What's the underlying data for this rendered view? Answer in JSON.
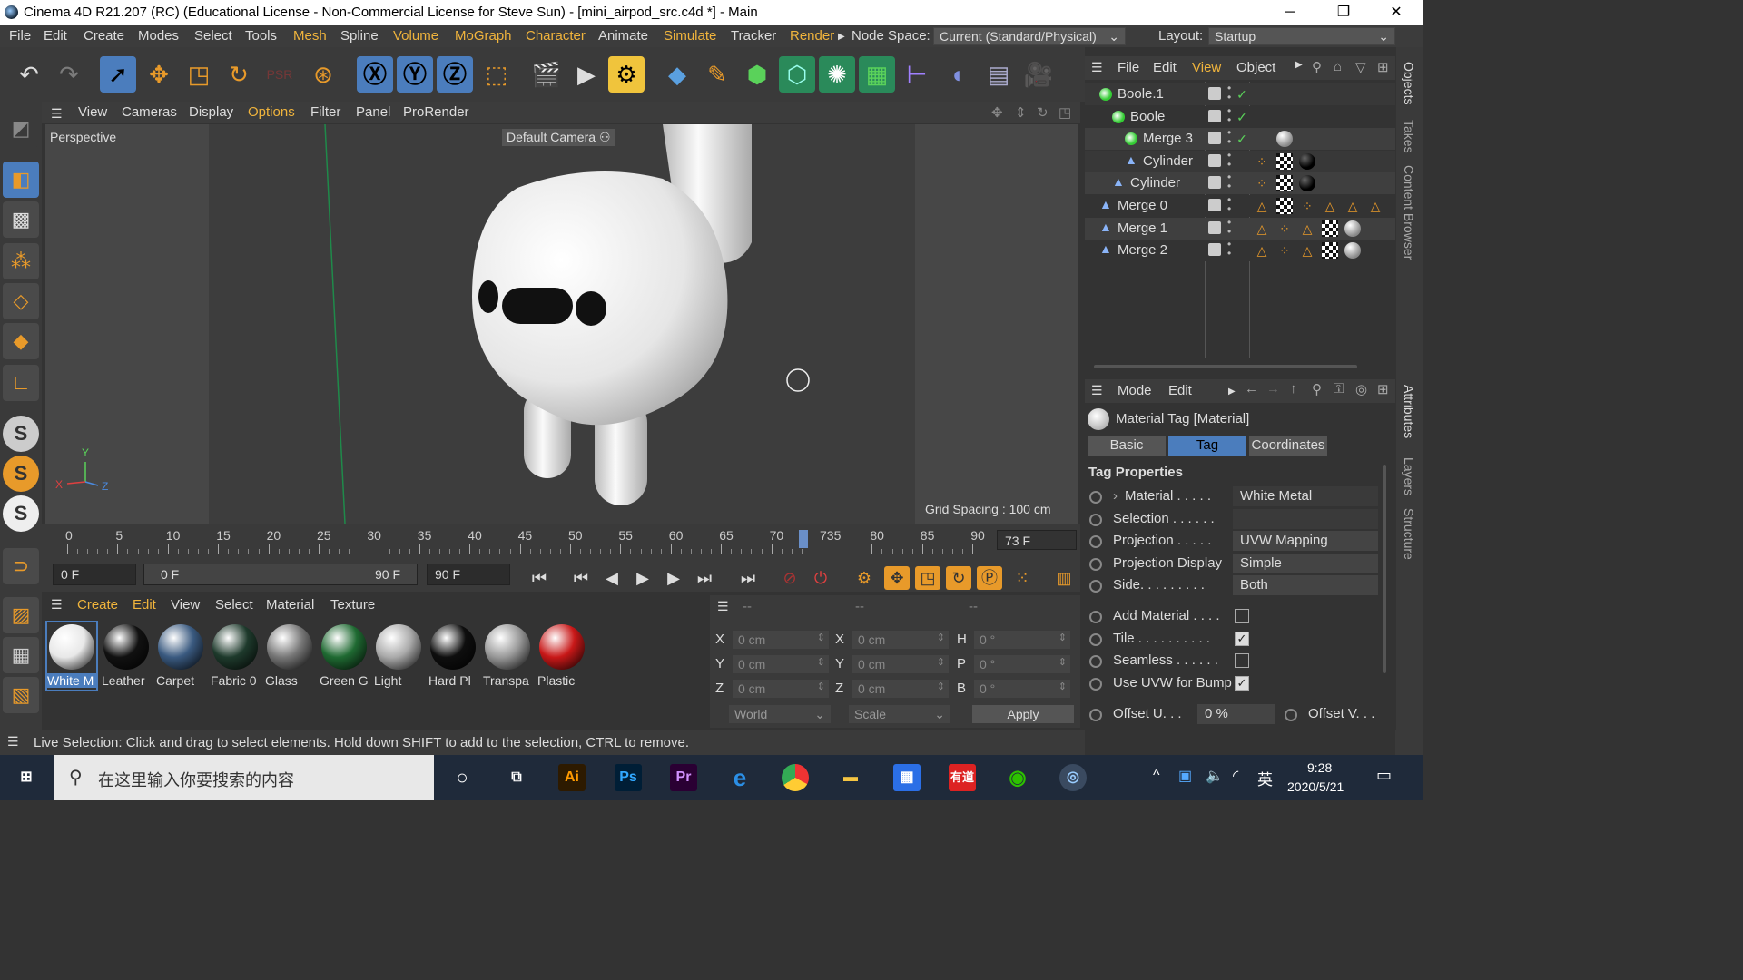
{
  "window": {
    "title": "Cinema 4D R21.207 (RC) (Educational License - Non-Commercial License for Steve Sun) - [mini_airpod_src.c4d *] - Main",
    "minimize": "─",
    "restore": "❐",
    "close": "✕"
  },
  "menu": {
    "items": [
      "File",
      "Edit",
      "Create",
      "Modes",
      "Select",
      "Tools",
      "Mesh",
      "Spline",
      "Volume",
      "MoGraph",
      "Character",
      "Animate",
      "Simulate",
      "Tracker",
      "Render"
    ],
    "node_space_label": "Node Space:",
    "node_space_value": "Current (Standard/Physical)",
    "layout_label": "Layout:",
    "layout_value": "Startup"
  },
  "viewport": {
    "menu": [
      "View",
      "Cameras",
      "Display",
      "Options",
      "Filter",
      "Panel",
      "ProRender"
    ],
    "name": "Perspective",
    "camera": "Default Camera",
    "grid_spacing": "Grid Spacing : 100 cm",
    "axis_x": "X",
    "axis_y": "Y",
    "axis_z": "Z"
  },
  "timeline": {
    "ticks": [
      "0",
      "5",
      "10",
      "15",
      "20",
      "25",
      "30",
      "35",
      "40",
      "45",
      "50",
      "55",
      "60",
      "65",
      "70",
      "735",
      "80",
      "85",
      "90"
    ],
    "current_frame": "73 F",
    "start_field": "0 F",
    "range_start": "0 F",
    "range_end": "90 F",
    "end_field": "90 F"
  },
  "materials": {
    "menu": [
      "Create",
      "Edit",
      "View",
      "Select",
      "Material",
      "Texture"
    ],
    "items": [
      {
        "label": "White M",
        "color": "#e8e8e8"
      },
      {
        "label": "Leather",
        "color": "#111111"
      },
      {
        "label": "Carpet",
        "color": "#3a5a80"
      },
      {
        "label": "Fabric 0",
        "color": "#1e3a2c"
      },
      {
        "label": "Glass",
        "color": "#777777"
      },
      {
        "label": "Green G",
        "color": "#1f6a32"
      },
      {
        "label": "Light",
        "color": "#aaaaaa"
      },
      {
        "label": "Hard Pl",
        "color": "#0e0e0e"
      },
      {
        "label": "Transpa",
        "color": "#999999"
      },
      {
        "label": "Plastic",
        "color": "#c81818"
      }
    ]
  },
  "coords": {
    "headers": [
      "--",
      "--",
      "--"
    ],
    "rows": [
      {
        "l1": "X",
        "v1": "0 cm",
        "l2": "X",
        "v2": "0 cm",
        "l3": "H",
        "v3": "0 °"
      },
      {
        "l1": "Y",
        "v1": "0 cm",
        "l2": "Y",
        "v2": "0 cm",
        "l3": "P",
        "v3": "0 °"
      },
      {
        "l1": "Z",
        "v1": "0 cm",
        "l2": "Z",
        "v2": "0 cm",
        "l3": "B",
        "v3": "0 °"
      }
    ],
    "world": "World",
    "scale": "Scale",
    "apply": "Apply"
  },
  "status": "Live Selection: Click and drag to select elements. Hold down SHIFT to add to the selection, CTRL to remove.",
  "objects": {
    "menu": [
      "File",
      "Edit",
      "View",
      "Object"
    ],
    "items": [
      {
        "name": "Boole.1"
      },
      {
        "name": "Boole"
      },
      {
        "name": "Merge 3"
      },
      {
        "name": "Cylinder"
      },
      {
        "name": "Cylinder"
      },
      {
        "name": "Merge 0"
      },
      {
        "name": "Merge 1"
      },
      {
        "name": "Merge 2"
      }
    ]
  },
  "attributes": {
    "menu": [
      "Mode",
      "Edit"
    ],
    "title": "Material Tag [Material]",
    "tabs": [
      "Basic",
      "Tag",
      "Coordinates"
    ],
    "section": "Tag Properties",
    "rows": [
      {
        "label": "Material . . . . .",
        "value": "White Metal"
      },
      {
        "label": "Selection . . . . . .",
        "value": ""
      },
      {
        "label": "Projection . . . . .",
        "value": "UVW Mapping"
      },
      {
        "label": "Projection Display",
        "value": "Simple"
      },
      {
        "label": "Side. . . . . . . . .",
        "value": "Both"
      }
    ],
    "checks": [
      {
        "label": "Add Material . . . .",
        "checked": false
      },
      {
        "label": "Tile . . . . . . . . . .",
        "checked": true
      },
      {
        "label": "Seamless . . . . . .",
        "checked": false
      },
      {
        "label": "Use UVW for Bump",
        "checked": true
      }
    ],
    "offset_u_label": "Offset U. . .",
    "offset_u_value": "0 %",
    "offset_v_label": "Offset V. . ."
  },
  "side_tabs": [
    "Objects",
    "Takes",
    "Content Browser",
    "Attributes",
    "Layers",
    "Structure"
  ],
  "taskbar": {
    "search_placeholder": "在这里输入你要搜索的内容",
    "time": "9:28",
    "date": "2020/5/21",
    "ime": "英"
  },
  "colors": {
    "accent": "#4b7dbd",
    "highlight_menu": "#f0b43c",
    "check_green": "#5ad25a"
  }
}
